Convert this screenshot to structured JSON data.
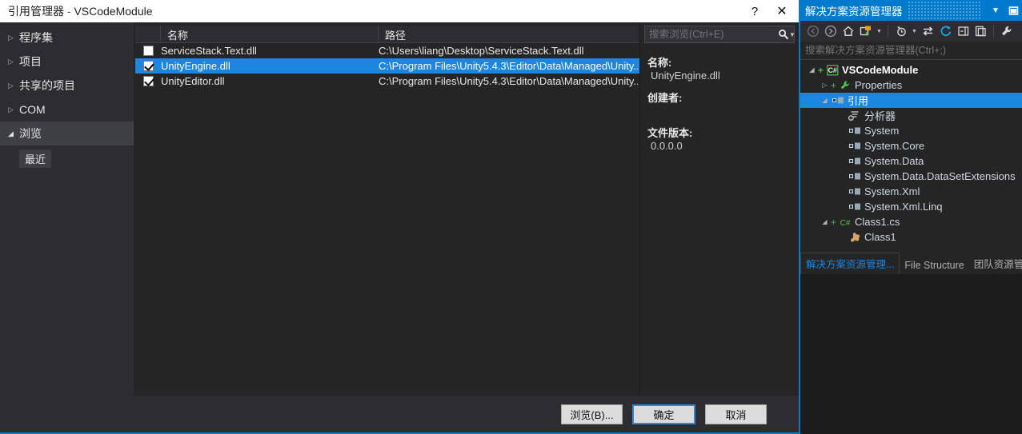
{
  "dialog": {
    "title_main": "引用管理器",
    "title_sep": " - ",
    "title_project": "VSCodeModule",
    "help_label": "?",
    "close_label": "✕",
    "nav": [
      {
        "label": "程序集",
        "expanded": false,
        "selected": false
      },
      {
        "label": "项目",
        "expanded": false,
        "selected": false
      },
      {
        "label": "共享的项目",
        "expanded": false,
        "selected": false
      },
      {
        "label": "COM",
        "expanded": false,
        "selected": false
      },
      {
        "label": "浏览",
        "expanded": true,
        "selected": true
      }
    ],
    "nav_sub": {
      "label": "最近"
    },
    "columns": {
      "name": "名称",
      "path": "路径"
    },
    "rows": [
      {
        "checked": false,
        "name": "ServiceStack.Text.dll",
        "path": "C:\\Users\\liang\\Desktop\\ServiceStack.Text.dll",
        "selected": false
      },
      {
        "checked": true,
        "name": "UnityEngine.dll",
        "path": "C:\\Program Files\\Unity5.4.3\\Editor\\Data\\Managed\\Unity...",
        "selected": true
      },
      {
        "checked": true,
        "name": "UnityEditor.dll",
        "path": "C:\\Program Files\\Unity5.4.3\\Editor\\Data\\Managed\\Unity...",
        "selected": false
      }
    ],
    "search": {
      "placeholder": "搜索浏览(Ctrl+E)",
      "value": ""
    },
    "detail": {
      "name_label": "名称:",
      "name_value": "UnityEngine.dll",
      "creator_label": "创建者:",
      "creator_value": "",
      "version_label": "文件版本:",
      "version_value": "0.0.0.0"
    },
    "buttons": {
      "browse": "浏览(B)...",
      "ok": "确定",
      "cancel": "取消"
    }
  },
  "solution_explorer": {
    "title": "解决方案资源管理器",
    "toolbar": [
      {
        "name": "back-icon"
      },
      {
        "name": "forward-icon"
      },
      {
        "name": "home-icon"
      },
      {
        "name": "project-view-icon"
      },
      {
        "name": "pending-changes-icon"
      },
      {
        "name": "sync-icon"
      },
      {
        "name": "refresh-icon"
      },
      {
        "name": "collapse-all-icon"
      },
      {
        "name": "show-all-files-icon"
      },
      {
        "name": "properties-icon"
      }
    ],
    "search": {
      "placeholder": "搜索解决方案资源管理器(Ctrl+;)",
      "value": ""
    },
    "tree": [
      {
        "label": "VSCodeModule",
        "indent": 0,
        "arrow": "open",
        "plus": true,
        "icon": "csharp-project-icon",
        "bold": true,
        "selected": false
      },
      {
        "label": "Properties",
        "indent": 1,
        "arrow": "closed",
        "plus": true,
        "icon": "wrench-icon",
        "bold": false,
        "selected": false
      },
      {
        "label": "引用",
        "indent": 1,
        "arrow": "open",
        "plus": false,
        "icon": "references-icon",
        "bold": false,
        "selected": true
      },
      {
        "label": "分析器",
        "indent": 2,
        "arrow": "none",
        "plus": false,
        "icon": "analyzer-icon",
        "bold": false,
        "selected": false
      },
      {
        "label": "System",
        "indent": 2,
        "arrow": "none",
        "plus": false,
        "icon": "reference-icon",
        "bold": false,
        "selected": false
      },
      {
        "label": "System.Core",
        "indent": 2,
        "arrow": "none",
        "plus": false,
        "icon": "reference-icon",
        "bold": false,
        "selected": false
      },
      {
        "label": "System.Data",
        "indent": 2,
        "arrow": "none",
        "plus": false,
        "icon": "reference-icon",
        "bold": false,
        "selected": false
      },
      {
        "label": "System.Data.DataSetExtensions",
        "indent": 2,
        "arrow": "none",
        "plus": false,
        "icon": "reference-icon",
        "bold": false,
        "selected": false
      },
      {
        "label": "System.Xml",
        "indent": 2,
        "arrow": "none",
        "plus": false,
        "icon": "reference-icon",
        "bold": false,
        "selected": false
      },
      {
        "label": "System.Xml.Linq",
        "indent": 2,
        "arrow": "none",
        "plus": false,
        "icon": "reference-icon",
        "bold": false,
        "selected": false
      },
      {
        "label": "Class1.cs",
        "indent": 1,
        "arrow": "open",
        "plus": true,
        "icon": "csharp-file-icon",
        "bold": false,
        "selected": false
      },
      {
        "label": "Class1",
        "indent": 2,
        "arrow": "none",
        "plus": false,
        "icon": "class-icon",
        "bold": false,
        "selected": false
      }
    ],
    "tabs": [
      {
        "label": "解决方案资源管理...",
        "active": true
      },
      {
        "label": "File Structure",
        "active": false
      },
      {
        "label": "团队资源管理器",
        "active": false
      }
    ]
  },
  "colors": {
    "accent_blue": "#007acc",
    "selection_blue": "#1c86e0",
    "panel_bg": "#252526",
    "nav_bg": "#2d2d30",
    "nav_selected": "#3f3f46",
    "green_plus": "#54b054"
  }
}
